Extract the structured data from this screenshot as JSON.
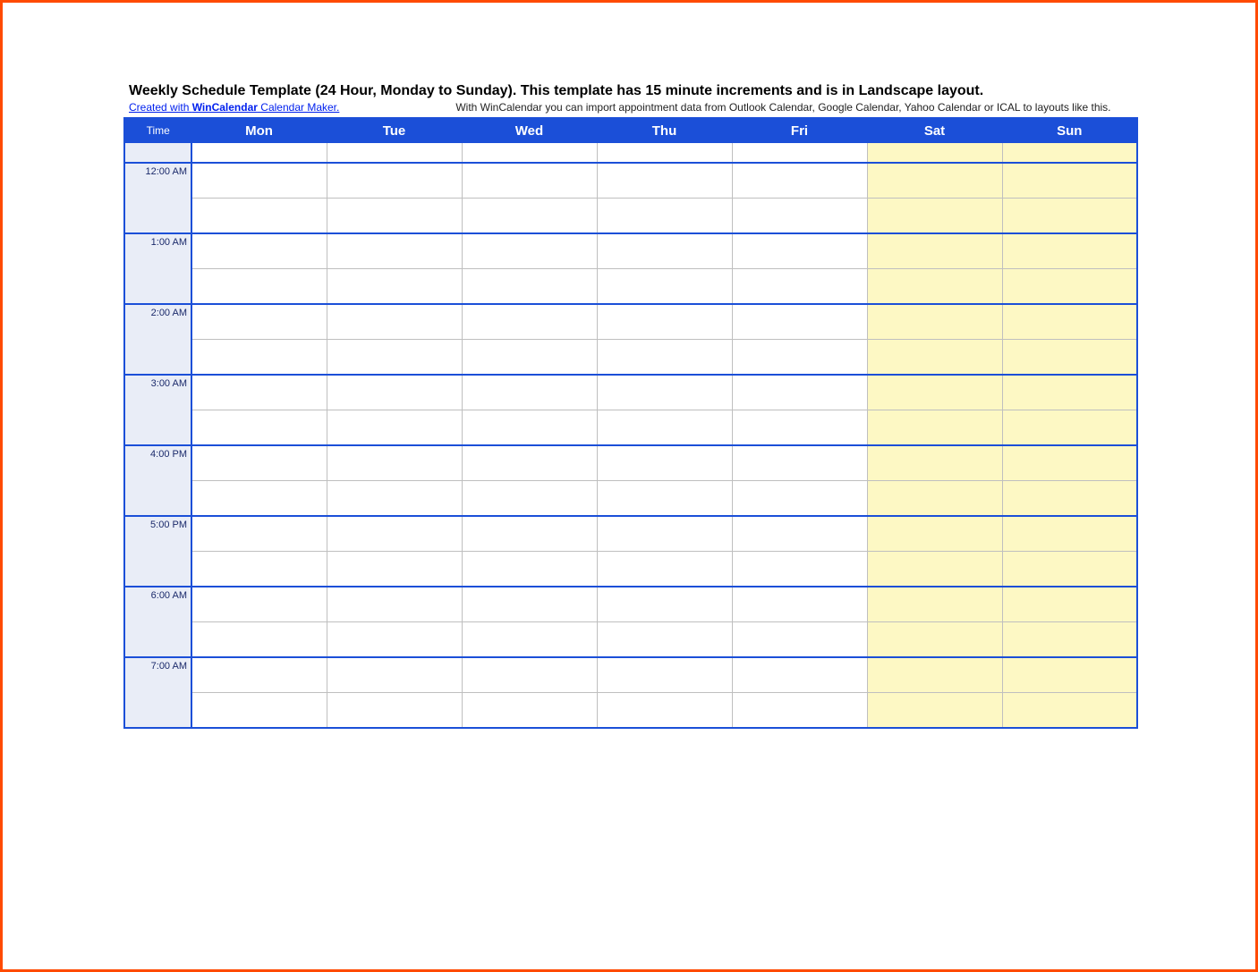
{
  "title": "Weekly Schedule Template (24 Hour, Monday to Sunday).  This template has 15 minute increments and is in Landscape layout.",
  "link_pre": "Created with ",
  "link_bold": "WinCalendar",
  "link_post": " Calendar Maker.",
  "note": "With WinCalendar you can import appointment data from Outlook Calendar, Google Calendar, Yahoo Calendar or ICAL to layouts like this.",
  "headers": {
    "time": "Time",
    "days": [
      "Mon",
      "Tue",
      "Wed",
      "Thu",
      "Fri",
      "Sat",
      "Sun"
    ]
  },
  "weekend_indices": [
    5,
    6
  ],
  "hours": [
    "12:00 AM",
    "1:00 AM",
    "2:00 AM",
    "3:00 AM",
    "4:00 PM",
    "5:00 PM",
    "6:00 AM",
    "7:00 AM"
  ]
}
